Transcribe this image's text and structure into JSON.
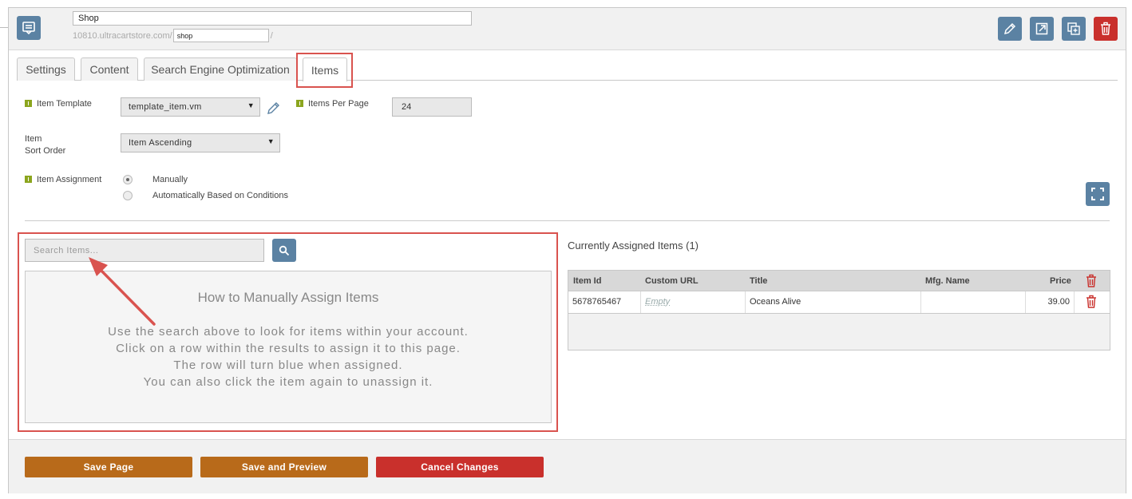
{
  "header": {
    "page_name": "Shop",
    "url_prefix": "10810.ultracartstore.com/",
    "url_slug": "shop",
    "url_suffix": "/",
    "actions": [
      "edit",
      "open-external",
      "copy",
      "delete"
    ]
  },
  "tabs": [
    {
      "label": "Settings",
      "active": false
    },
    {
      "label": "Content",
      "active": false
    },
    {
      "label": "Search Engine Optimization",
      "active": false
    },
    {
      "label": "Items",
      "active": true
    }
  ],
  "settings": {
    "item_template_label": "Item Template",
    "item_template_value": "template_item.vm",
    "items_per_page_label": "Items Per Page",
    "items_per_page_value": "24",
    "sort_order_label_line1": "Item",
    "sort_order_label_line2": "Sort Order",
    "sort_order_value": "Item Ascending",
    "assignment_label": "Item Assignment",
    "assignment_options": [
      {
        "label": "Manually",
        "selected": true
      },
      {
        "label": "Automatically Based on Conditions",
        "selected": false
      }
    ]
  },
  "search": {
    "placeholder": "Search Items..."
  },
  "help": {
    "title": "How to Manually Assign Items",
    "lines": [
      "Use the search above to look for items within your account.",
      "Click on a row within the results to assign it to this page.",
      "The row will turn blue when assigned.",
      "You can also click the item again to unassign it."
    ]
  },
  "assigned": {
    "title": "Currently Assigned Items (1)",
    "columns": [
      "Item Id",
      "Custom URL",
      "Title",
      "Mfg. Name",
      "Price"
    ],
    "rows": [
      {
        "item_id": "5678765467",
        "custom_url": "Empty",
        "title": "Oceans Alive",
        "mfg_name": "",
        "price": "39.00"
      }
    ]
  },
  "footer": {
    "save_label": "Save Page",
    "preview_label": "Save and Preview",
    "cancel_label": "Cancel Changes"
  },
  "colors": {
    "accent_blue": "#5b82a3",
    "orange": "#b86a1a",
    "danger": "#c9302c",
    "highlight": "#d9534f",
    "setting_marker": "#8ba51e"
  }
}
